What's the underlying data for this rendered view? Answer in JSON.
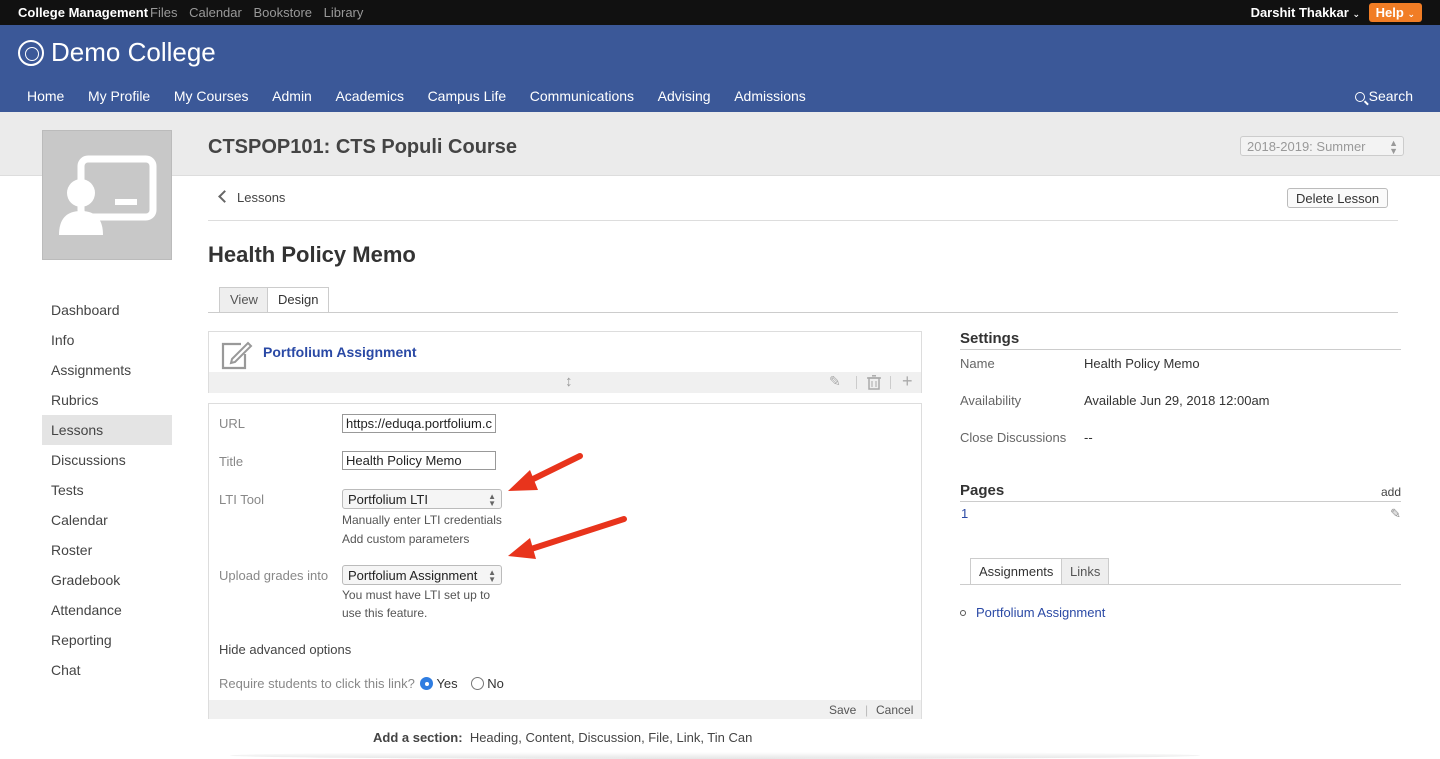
{
  "topbar": {
    "app_name": "College Management",
    "links": [
      "Files",
      "Calendar",
      "Bookstore",
      "Library"
    ],
    "user": "Darshit Thakkar",
    "help": "Help"
  },
  "header": {
    "college_name": "Demo College",
    "nav": [
      "Home",
      "My Profile",
      "My Courses",
      "Admin",
      "Academics",
      "Campus Life",
      "Communications",
      "Advising",
      "Admissions"
    ],
    "search": "Search"
  },
  "course": {
    "title": "CTSPOP101: CTS Populi Course",
    "term": "2018-2019: Summer"
  },
  "leftnav": [
    "Dashboard",
    "Info",
    "Assignments",
    "Rubrics",
    "Lessons",
    "Discussions",
    "Tests",
    "Calendar",
    "Roster",
    "Gradebook",
    "Attendance",
    "Reporting",
    "Chat"
  ],
  "breadcrumb": "Lessons",
  "delete_button": "Delete Lesson",
  "lesson_title": "Health Policy Memo",
  "tabs": [
    "View",
    "Design"
  ],
  "section": {
    "title": "Portfolium Assignment"
  },
  "form": {
    "url_label": "URL",
    "url_value": "https://eduqa.portfolium.c",
    "title_label": "Title",
    "title_value": "Health Policy Memo",
    "lti_label": "LTI Tool",
    "lti_value": "Portfolium LTI",
    "lti_help1": "Manually enter LTI credentials",
    "lti_help2": "Add custom parameters",
    "upload_label": "Upload grades into",
    "upload_value": "Portfolium Assignment",
    "upload_help1": "You must have LTI set up to",
    "upload_help2": "use this feature.",
    "hide_adv": "Hide advanced options",
    "require_label": "Require students to click this link?",
    "yes": "Yes",
    "no": "No",
    "save": "Save",
    "sep": "|",
    "cancel": "Cancel"
  },
  "add_section": {
    "label": "Add a section:",
    "options": "Heading, Content, Discussion, File, Link, Tin Can"
  },
  "settings": {
    "heading": "Settings",
    "name_k": "Name",
    "name_v": "Health Policy Memo",
    "avail_k": "Availability",
    "avail_v": "Available Jun 29, 2018 12:00am",
    "close_k": "Close Discussions",
    "close_v": "--"
  },
  "pages": {
    "heading": "Pages",
    "add": "add",
    "page_num": "1"
  },
  "right_tabs": [
    "Assignments",
    "Links"
  ],
  "right_list": [
    "Portfolium Assignment"
  ],
  "colors": {
    "header_blue": "#3b5898",
    "help_orange": "#f17d25",
    "link_blue": "#2a49a5",
    "arrow_red": "#e8341c"
  }
}
